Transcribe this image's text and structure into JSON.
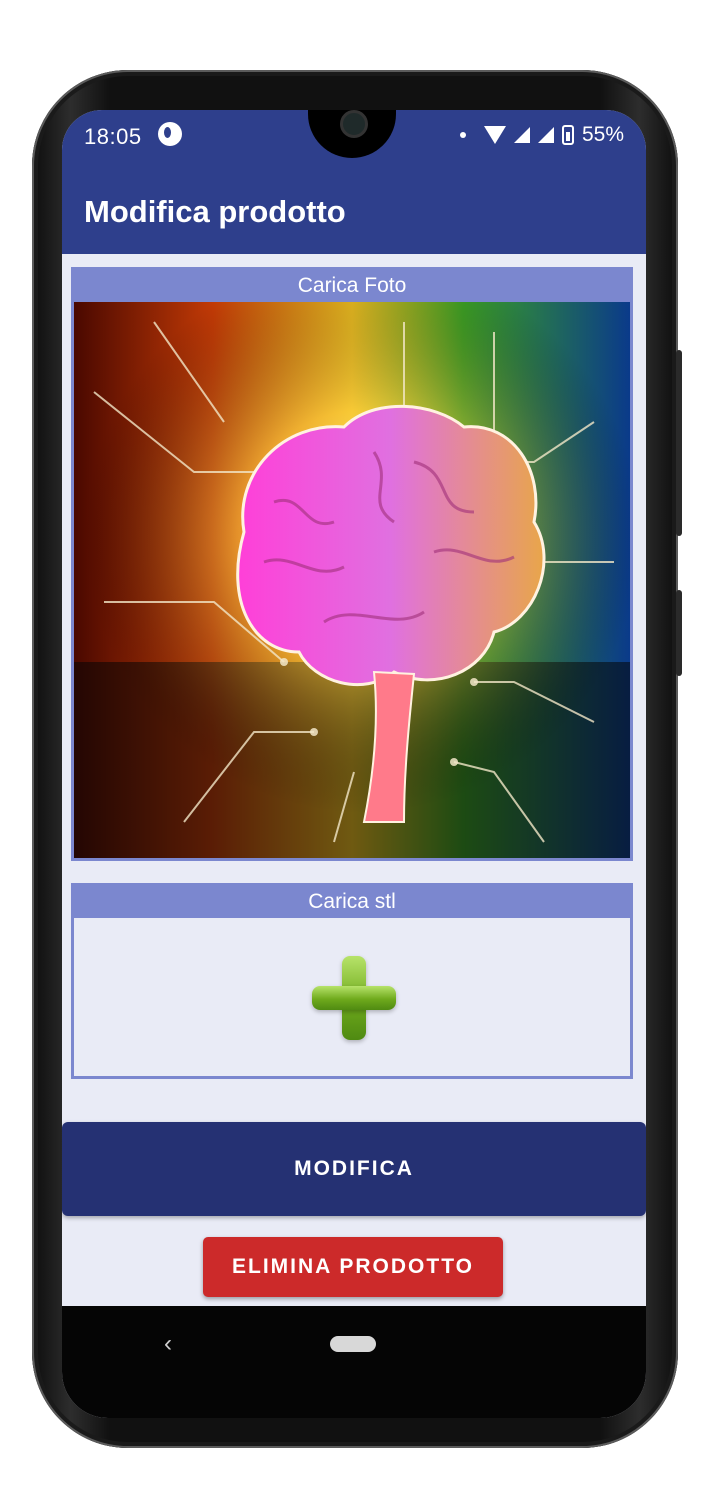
{
  "statusbar": {
    "time": "18:05",
    "battery_percent": "55%",
    "icons": [
      "notification-app-icon",
      "wifi-icon",
      "signal-icon",
      "signal-icon",
      "battery-charging-icon"
    ]
  },
  "appbar": {
    "title": "Modifica prodotto"
  },
  "photo_section": {
    "header": "Carica Foto",
    "image_subject": "glowing brain circuit artwork"
  },
  "stl_section": {
    "header": "Carica stl",
    "icon": "plus-icon"
  },
  "buttons": {
    "modifica": "MODIFICA",
    "elimina": "ELIMINA PRODOTTO"
  },
  "navbar": {
    "back_glyph": "‹"
  },
  "colors": {
    "primary": "#2e3f8c",
    "primary_dark": "#253173",
    "accent": "#7b87cf",
    "background": "#e9ebf6",
    "danger": "#cc2a2a"
  }
}
